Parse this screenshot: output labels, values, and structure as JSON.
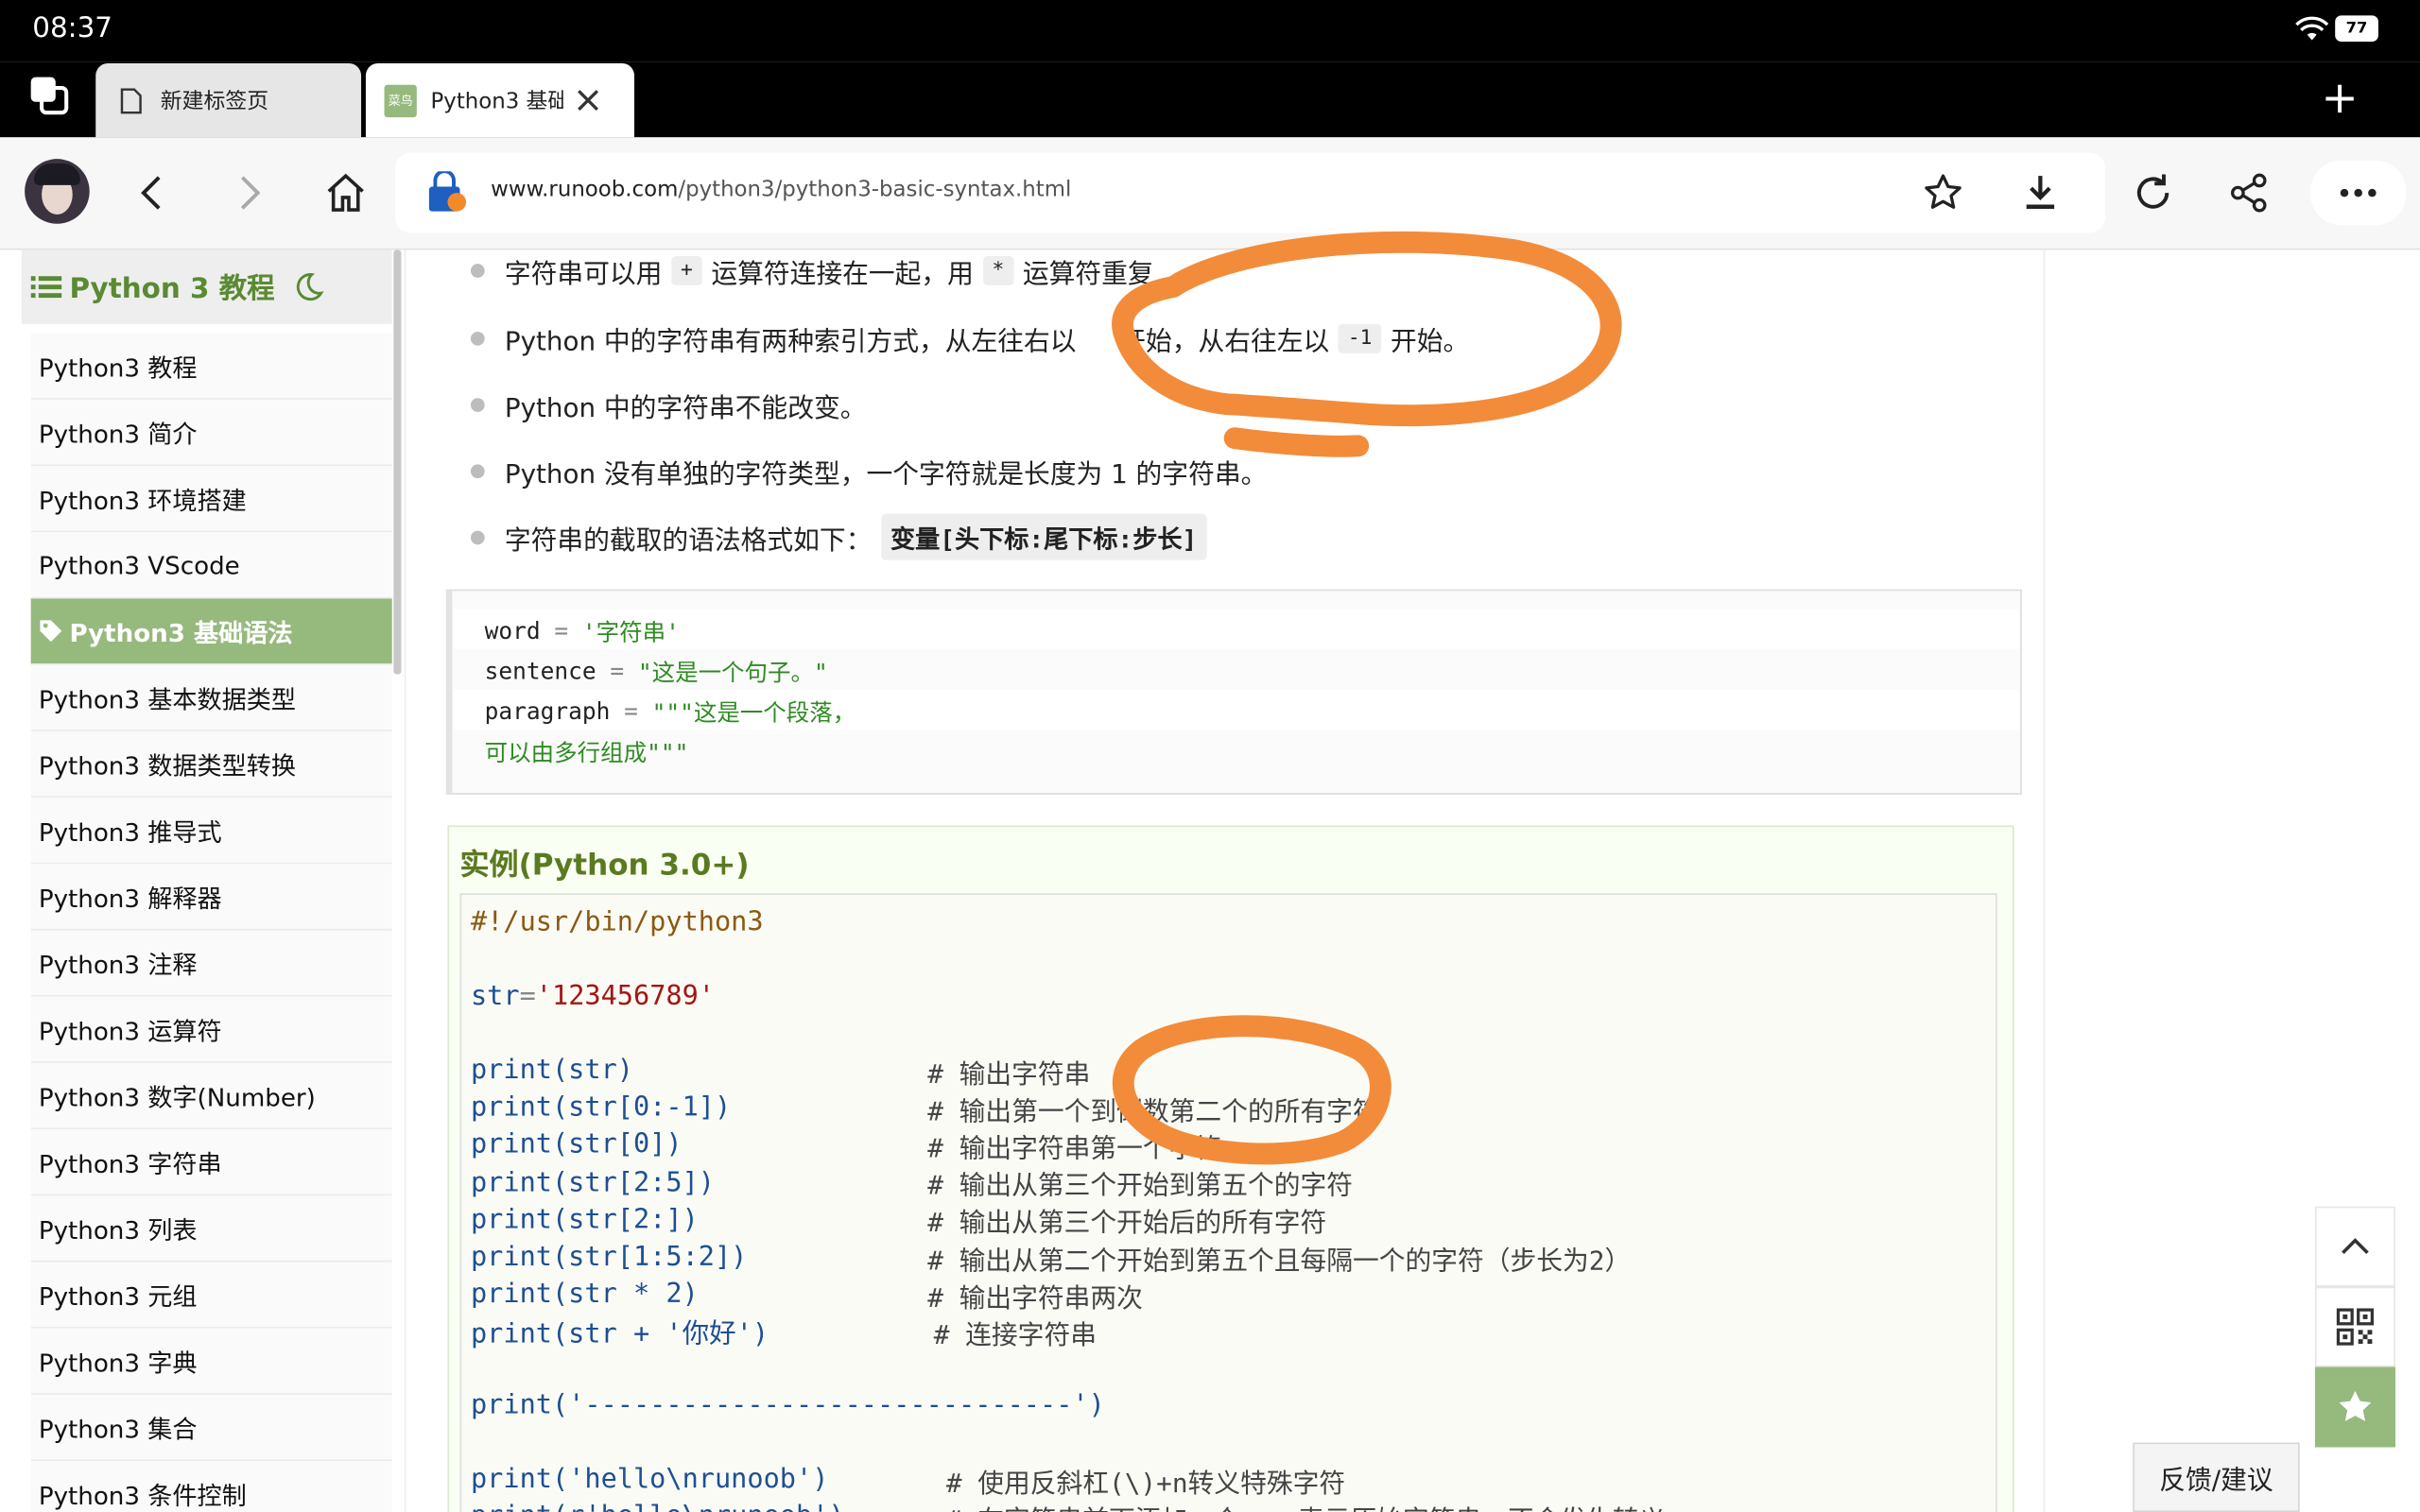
{
  "status": {
    "time": "08:37",
    "battery": "77"
  },
  "tabs": [
    {
      "label": "新建标签页"
    },
    {
      "label": "Python3 基础",
      "favicon_text": "菜鸟"
    }
  ],
  "toolbar": {
    "url_domain": "www.runoob.com",
    "url_path": "/python3/python3-basic-syntax.html"
  },
  "sidebar": {
    "title": "Python 3 教程",
    "items": [
      {
        "label": "Python3 教程"
      },
      {
        "label": "Python3 简介"
      },
      {
        "label": "Python3 环境搭建"
      },
      {
        "label": "Python3 VScode"
      },
      {
        "label": "Python3 基础语法",
        "active": true
      },
      {
        "label": "Python3 基本数据类型"
      },
      {
        "label": "Python3 数据类型转换"
      },
      {
        "label": "Python3 推导式"
      },
      {
        "label": "Python3 解释器"
      },
      {
        "label": "Python3 注释"
      },
      {
        "label": "Python3 运算符"
      },
      {
        "label": "Python3 数字(Number)"
      },
      {
        "label": "Python3 字符串"
      },
      {
        "label": "Python3 列表"
      },
      {
        "label": "Python3 元组"
      },
      {
        "label": "Python3 字典"
      },
      {
        "label": "Python3 集合"
      },
      {
        "label": "Python3 条件控制"
      }
    ]
  },
  "content": {
    "bullets": {
      "b1_a": "字符串可以用",
      "b1_op1": "+",
      "b1_b": "运算符连接在一起，用",
      "b1_op2": "*",
      "b1_c": "运算符重复",
      "b2_a": "Python 中的字符串有两种索引方式，从左往右以",
      "b2_b": "开始，从右往左以",
      "b2_op": "-1",
      "b2_c": "开始。",
      "b3": "Python 中的字符串不能改变。",
      "b4": "Python 没有单独的字符类型，一个字符就是长度为 1 的字符串。",
      "b5_a": "字符串的截取的语法格式如下：",
      "b5_code": "变量[头下标:尾下标:步长]"
    },
    "code_block": [
      {
        "a": "word",
        "op": " = ",
        "s": "'字符串'"
      },
      {
        "a": "sentence",
        "op": " = ",
        "s": "\"这是一个句子。\""
      },
      {
        "a": "paragraph",
        "op": " = ",
        "s": "\"\"\"这是一个段落，"
      },
      {
        "a": "",
        "op": "",
        "s": "可以由多行组成\"\"\""
      }
    ],
    "example": {
      "title": "实例(Python 3.0+)",
      "shebang": "#!/usr/bin/python3",
      "assign": {
        "name": "str",
        "eq": "=",
        "val": "'123456789'"
      },
      "lines": [
        {
          "code": "print(str)",
          "comment": "# 输出字符串"
        },
        {
          "code": "print(str[0:-1])",
          "comment": "# 输出第一个到倒数第二个的所有字符"
        },
        {
          "code": "print(str[0])",
          "comment": "# 输出字符串第一个字符"
        },
        {
          "code": "print(str[2:5])",
          "comment": "# 输出从第三个开始到第五个的字符"
        },
        {
          "code": "print(str[2:])",
          "comment": "# 输出从第三个开始后的所有字符"
        },
        {
          "code": "print(str[1:5:2])",
          "comment": "# 输出从第二个开始到第五个且每隔一个的字符（步长为2）"
        },
        {
          "code": "print(str * 2)",
          "comment": "# 输出字符串两次"
        },
        {
          "code": "print(str + '你好')",
          "comment": "# 连接字符串"
        }
      ],
      "separator": "print('------------------------------')",
      "escape_code": "print('hello\\nrunoob')",
      "escape_comment": "# 使用反斜杠(\\)+n转义特殊字符",
      "raw_code": "print(r'hello\\nrunoob')",
      "raw_comment": "# 在字符串前面添加一个 r，表示原始字符串，不会发生转义"
    }
  },
  "floating": {
    "feedback": "反馈/建议"
  }
}
